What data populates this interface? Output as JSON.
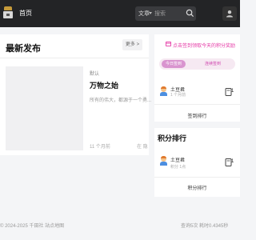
{
  "nav": {
    "home_label": "首页"
  },
  "search": {
    "type_label": "文章",
    "placeholder": "搜索"
  },
  "main": {
    "section_title": "最新发布",
    "more_label": "更多 >",
    "article": {
      "category": "默认",
      "title": "万物之始",
      "excerpt": "所有的伟大，都源于一个勇...",
      "meta_views": "11 个月前",
      "meta_extra": "在 隐"
    }
  },
  "sidebar": {
    "checkin_text": "点击签到领取今天的积分奖励",
    "tabs": [
      "今日签到",
      "连续签到"
    ],
    "checkin_user": {
      "name": "土豆君",
      "sub": "1 个月前",
      "count": "1"
    },
    "checkin_link": "签到排行",
    "points_title": "积分排行",
    "points_user": {
      "name": "土豆君",
      "sub": "积分 1点",
      "count": "1"
    },
    "points_link": "积分排行"
  },
  "footer": {
    "left": "© 2024-2025 千田社 站点地图",
    "right": "查询5次 耗时0.4345秒"
  },
  "colors": {
    "topbar": "#232426",
    "accent_pink": "#e53aa6",
    "tab_active": "#d994cf"
  }
}
